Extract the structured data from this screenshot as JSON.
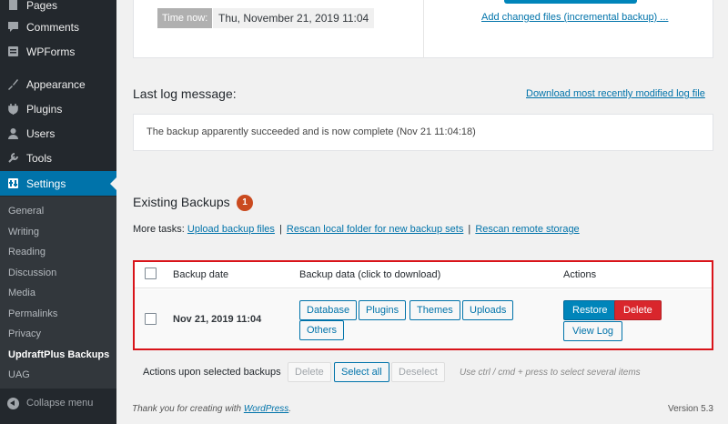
{
  "sidebar": {
    "items": [
      {
        "label": "Pages",
        "icon": "pages-icon"
      },
      {
        "label": "Comments",
        "icon": "comments-icon"
      },
      {
        "label": "WPForms",
        "icon": "wpforms-icon"
      },
      {
        "label": "Appearance",
        "icon": "appearance-icon"
      },
      {
        "label": "Plugins",
        "icon": "plugins-icon"
      },
      {
        "label": "Users",
        "icon": "users-icon"
      },
      {
        "label": "Tools",
        "icon": "tools-icon"
      },
      {
        "label": "Settings",
        "icon": "settings-icon",
        "active": true
      }
    ],
    "submenu": [
      "General",
      "Writing",
      "Reading",
      "Discussion",
      "Media",
      "Permalinks",
      "Privacy",
      "UpdraftPlus Backups",
      "UAG"
    ],
    "submenu_current": "UpdraftPlus Backups",
    "collapse_label": "Collapse menu"
  },
  "top_card": {
    "time_label": "Time now:",
    "time_value": "Thu, November 21, 2019 11:04",
    "incremental_link": "Add changed files (incremental backup) ..."
  },
  "log": {
    "title": "Last log message:",
    "download_link": "Download most recently modified log file",
    "message": "The backup apparently succeeded and is now complete (Nov 21 11:04:18)"
  },
  "existing": {
    "title": "Existing Backups",
    "count": "1",
    "more_tasks_label": "More tasks:",
    "tasks": [
      "Upload backup files",
      "Rescan local folder for new backup sets",
      "Rescan remote storage"
    ],
    "separator": "|"
  },
  "table": {
    "headers": {
      "date": "Backup date",
      "data": "Backup data (click to download)",
      "actions": "Actions"
    },
    "row": {
      "date": "Nov 21, 2019 11:04",
      "data_buttons": [
        "Database",
        "Plugins",
        "Themes",
        "Uploads",
        "Others"
      ],
      "restore": "Restore",
      "delete": "Delete",
      "view_log": "View Log"
    }
  },
  "selection": {
    "label": "Actions upon selected backups",
    "delete": "Delete",
    "select_all": "Select all",
    "deselect": "Deselect",
    "hint": "Use ctrl / cmd + press to select several items"
  },
  "footer": {
    "thanks_prefix": "Thank you for creating with ",
    "wordpress_link": "WordPress",
    "thanks_suffix": ".",
    "version": "Version 5.3"
  },
  "colors": {
    "sidebar_bg": "#23282d",
    "submenu_bg": "#32373c",
    "active_blue": "#0073aa",
    "highlight_red": "#d9141a",
    "badge": "#ca4a1f"
  }
}
